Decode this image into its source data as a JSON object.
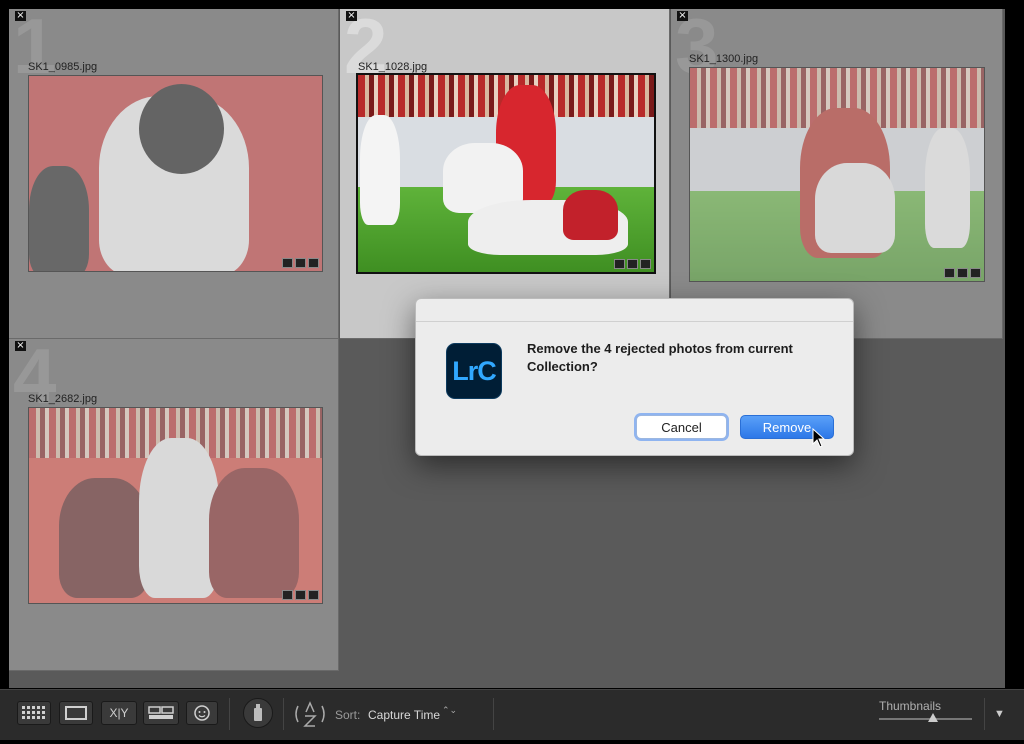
{
  "grid": {
    "cells": [
      {
        "index": "1",
        "filename": "SK1_0985.jpg",
        "flag": "×"
      },
      {
        "index": "2",
        "filename": "SK1_1028.jpg",
        "flag": "×"
      },
      {
        "index": "3",
        "filename": "SK1_1300.jpg",
        "flag": "×"
      },
      {
        "index": "4",
        "filename": "SK1_2682.jpg",
        "flag": "×"
      }
    ]
  },
  "dialog": {
    "logo": "LrC",
    "message": "Remove the 4 rejected photos from current Collection?",
    "cancel_label": "Cancel",
    "remove_label": "Remove"
  },
  "toolbar": {
    "compare_label": "X|Y",
    "sort_label": "Sort:",
    "sort_value": "Capture Time",
    "sort_chevron": "⌃⌄",
    "thumbnails_label": "Thumbnails",
    "thumbnail_size": 0.58,
    "menu_icon": "▼"
  },
  "colors": {
    "accent": "#2d78e8",
    "logo_bg": "#001e36",
    "logo_fg": "#31a8ff"
  }
}
